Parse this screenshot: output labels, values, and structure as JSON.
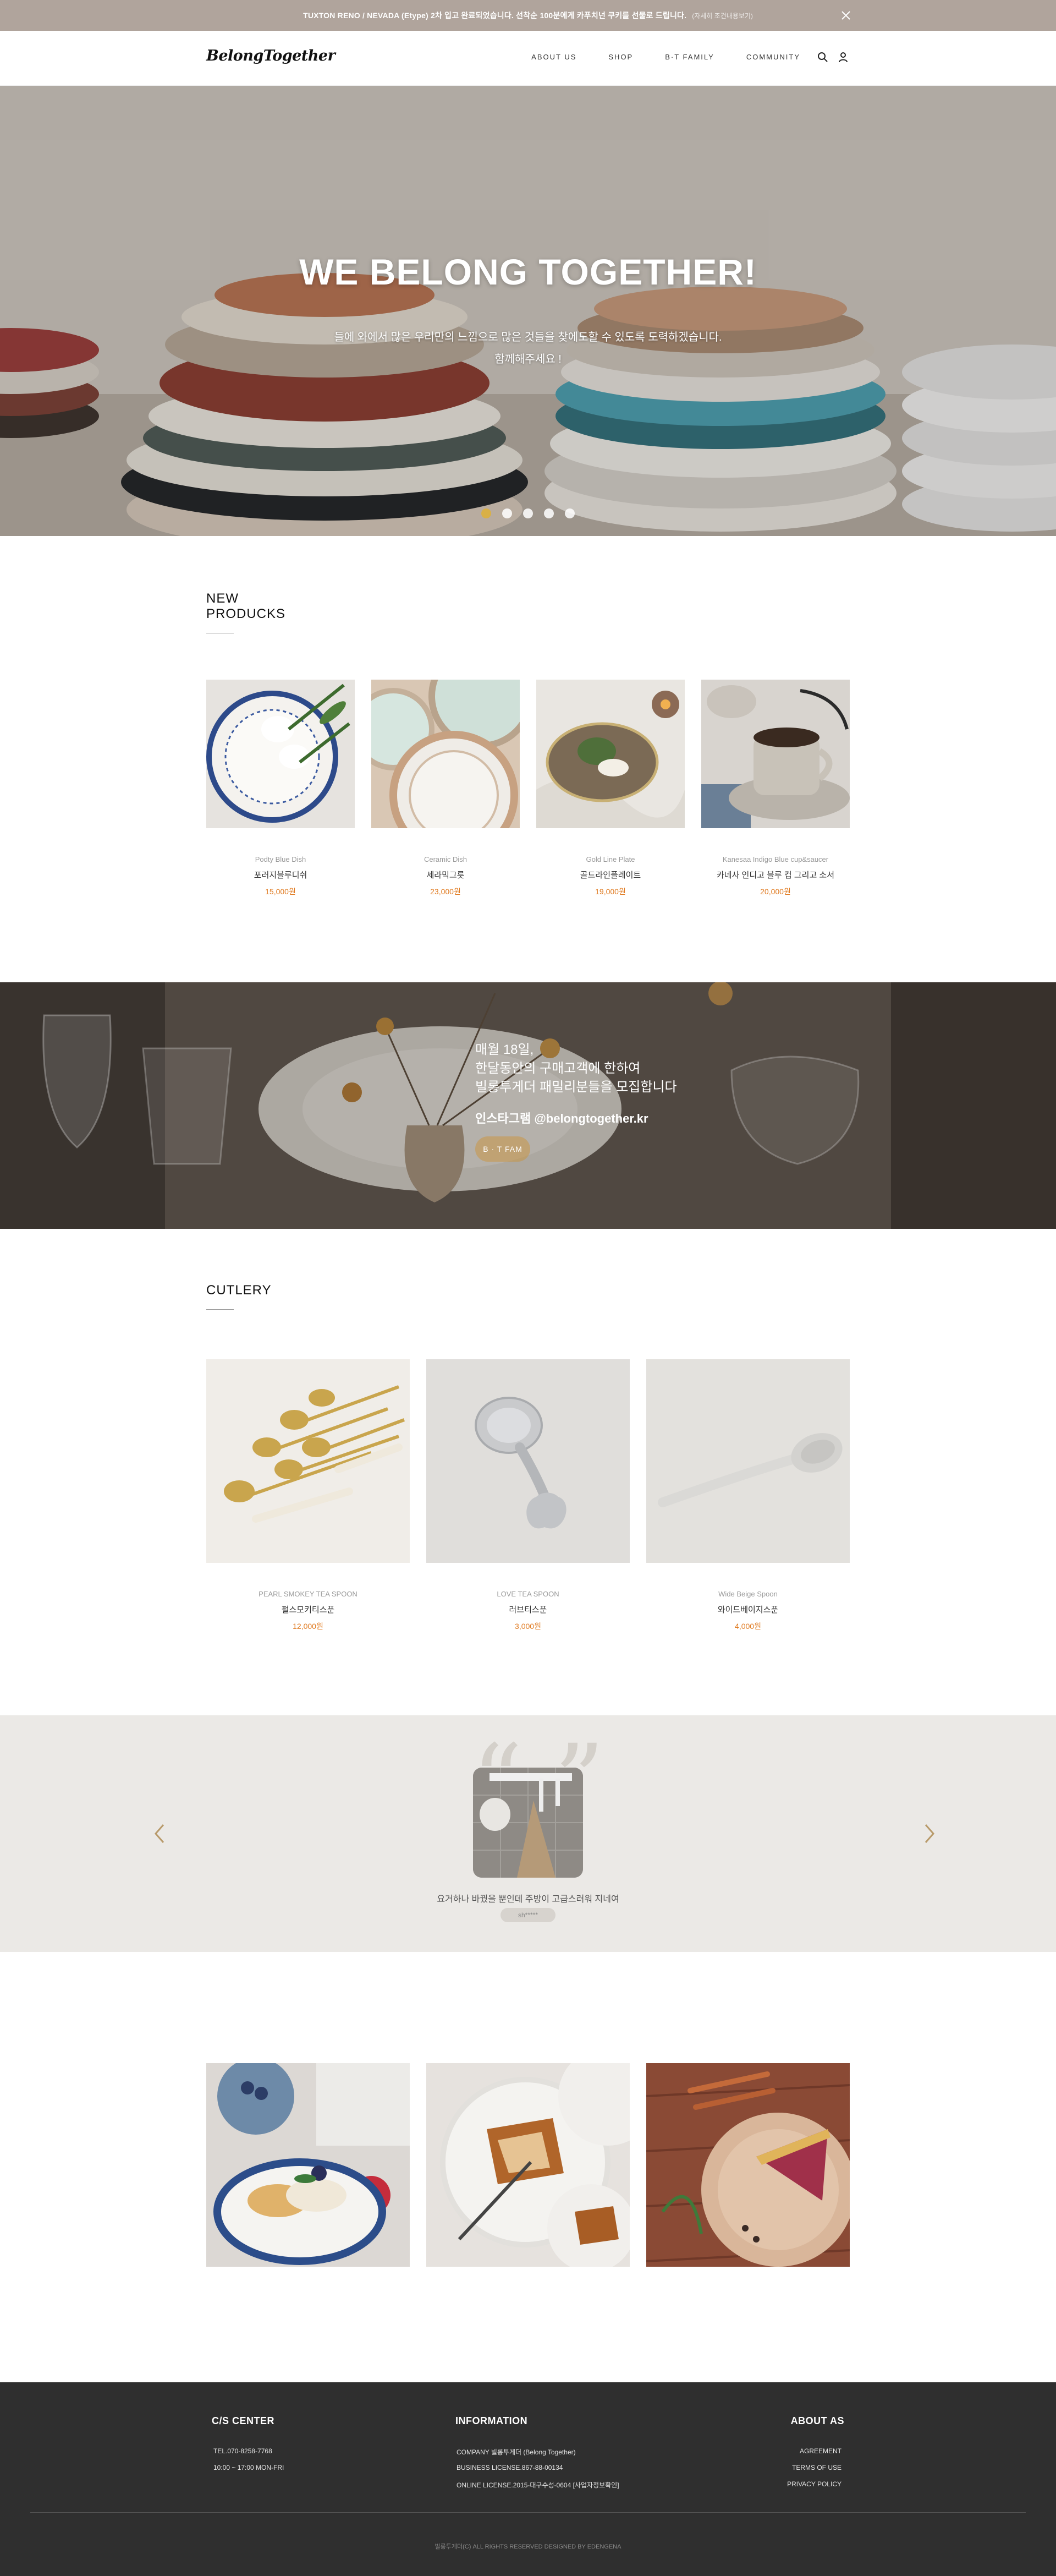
{
  "topbar": {
    "notice": "TUXTON RENO / NEVADA (Etype) 2차 입고 완료되었습니다. 선착순 100분에게 카푸치넌 쿠키를 선물로 드립니다.",
    "more": "(자세히 조건내용보기)"
  },
  "header": {
    "logo": "BelongTogether",
    "nav": [
      "ABOUT US",
      "SHOP",
      "B·T FAMILY",
      "COMMUNITY"
    ]
  },
  "hero": {
    "title": "WE BELONG TOGETHER!",
    "line1": "들에 와에서 많은 우리만의 느낌으로 많은 것들을 찾에도할 수 있도록 도력하겠습니다.",
    "line2": "함께해주세요 !",
    "slides": 5,
    "active_slide": 1
  },
  "new_products": {
    "title_line1": "NEW",
    "title_line2": "PRODUCKS",
    "items": [
      {
        "en": "Podty Blue Dish",
        "ko": "포러지블루디쉬",
        "price": "15,000원"
      },
      {
        "en": "Ceramic Dish",
        "ko": "세라믹그릇",
        "price": "23,000원"
      },
      {
        "en": "Gold Line Plate",
        "ko": "골드라인플레이트",
        "price": "19,000원"
      },
      {
        "en": "Kanesaa Indigo Blue cup&saucer",
        "ko": "카네사 인디고 블루 컵 그리고 소서",
        "price": "20,000원"
      }
    ]
  },
  "banner": {
    "line1": "매월 18일,",
    "line2": "한달동안의 구매고객에 한하여",
    "line3": "빌롱투게더 패밀리분들을 모집합니다",
    "instagram": "인스타그램 @belongtogether.kr",
    "button": "B · T FAM"
  },
  "cutlery": {
    "title": "CUTLERY",
    "items": [
      {
        "en": "PEARL SMOKEY TEA SPOON",
        "ko": "펄스모키티스푼",
        "price": "12,000원"
      },
      {
        "en": "LOVE TEA SPOON",
        "ko": "러브티스푼",
        "price": "3,000원"
      },
      {
        "en": "Wide Beige Spoon",
        "ko": "와이드베이지스푼",
        "price": "4,000원"
      }
    ]
  },
  "review": {
    "caption": "요거하나 바꿨을 뿐인데 주방이 고급스러워 지네여",
    "author": "sh*****"
  },
  "footer": {
    "cs_title": "C/S CENTER",
    "cs_tel": "TEL.070-8258-7768",
    "cs_hours": "10:00 ~ 17:00 MON-FRI",
    "info_title": "INFORMATION",
    "info_company": "COMPANY 빌롱투게더 (Belong Together)",
    "info_license": "BUSINESS LICENSE.867-88-00134",
    "info_online": "ONLINE LICENSE.2015-대구수성-0604 [사업자정보확인]",
    "about_title": "ABOUT AS",
    "about_links": [
      "AGREEMENT",
      "TERMS OF USE",
      "PRIVACY POLICY"
    ],
    "copyright": "빌롱투게더(C) ALL RIGHTS RESERVED DESIGNED BY EDENGENA"
  }
}
